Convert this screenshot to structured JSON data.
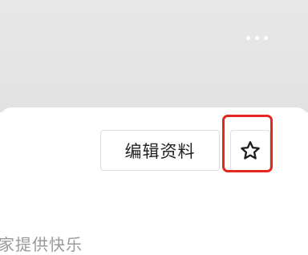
{
  "header": {
    "more_icon": "more-dots-icon"
  },
  "profile": {
    "edit_button_label": "编辑资料",
    "favorite_icon": "star-outline-icon",
    "bio_text": "家提供快乐"
  },
  "highlight_color": "#e5281d"
}
